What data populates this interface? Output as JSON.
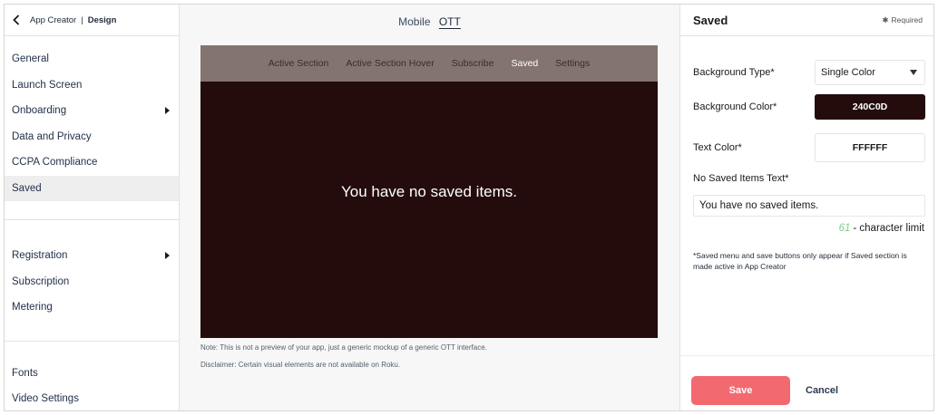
{
  "sidebar": {
    "header": {
      "app": "App Creator",
      "separator": "|",
      "section": "Design"
    },
    "groups": [
      {
        "items": [
          {
            "label": "General",
            "has_submenu": false
          },
          {
            "label": "Launch Screen",
            "has_submenu": false
          },
          {
            "label": "Onboarding",
            "has_submenu": true
          },
          {
            "label": "Data and Privacy",
            "has_submenu": false
          },
          {
            "label": "CCPA Compliance",
            "has_submenu": false
          },
          {
            "label": "Saved",
            "has_submenu": false,
            "active": true
          }
        ]
      },
      {
        "items": [
          {
            "label": "Registration",
            "has_submenu": true
          },
          {
            "label": "Subscription",
            "has_submenu": false
          },
          {
            "label": "Metering",
            "has_submenu": false
          }
        ]
      },
      {
        "items": [
          {
            "label": "Fonts",
            "has_submenu": false
          },
          {
            "label": "Video Settings",
            "has_submenu": false
          }
        ]
      }
    ]
  },
  "preview": {
    "toggle": {
      "mobile": "Mobile",
      "ott": "OTT",
      "selected": "OTT"
    },
    "nav": [
      "Active Section",
      "Active Section Hover",
      "Subscribe",
      "Saved",
      "Settings"
    ],
    "nav_active": "Saved",
    "empty_message": "You have no saved items.",
    "note": "Note: This is not a preview of your app, just a generic mockup of a generic OTT interface.",
    "disclaimer": "Disclaimer: Certain visual elements are not available on Roku."
  },
  "panel": {
    "title": "Saved",
    "required_label": "Required",
    "background_type": {
      "label": "Background Type*",
      "value": "Single Color"
    },
    "background_color": {
      "label": "Background Color*",
      "value": "240C0D",
      "hex": "#240C0D"
    },
    "text_color": {
      "label": "Text Color*",
      "value": "FFFFFF",
      "hex": "#FFFFFF"
    },
    "no_saved_text": {
      "label": "No Saved Items Text*",
      "value": "You have no saved items.",
      "char_count": "61",
      "char_suffix": "- character limit"
    },
    "hint": "*Saved menu and save buttons only appear if Saved section is made active in App Creator",
    "save_label": "Save",
    "cancel_label": "Cancel"
  },
  "colors": {
    "accent": "#F26A6F",
    "nav_bar": "#847470",
    "mock_bg": "#240C0D",
    "char_count": "#7FCF8A"
  }
}
